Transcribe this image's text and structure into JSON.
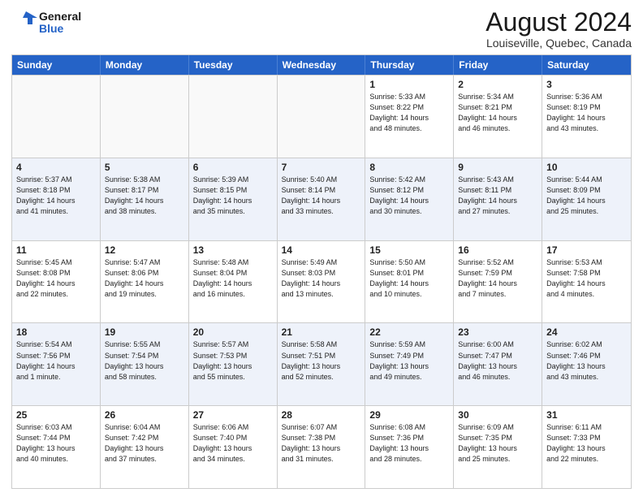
{
  "header": {
    "logo_line1": "General",
    "logo_line2": "Blue",
    "month": "August 2024",
    "location": "Louiseville, Quebec, Canada"
  },
  "days_of_week": [
    "Sunday",
    "Monday",
    "Tuesday",
    "Wednesday",
    "Thursday",
    "Friday",
    "Saturday"
  ],
  "weeks": [
    [
      {
        "day": "",
        "info": ""
      },
      {
        "day": "",
        "info": ""
      },
      {
        "day": "",
        "info": ""
      },
      {
        "day": "",
        "info": ""
      },
      {
        "day": "1",
        "info": "Sunrise: 5:33 AM\nSunset: 8:22 PM\nDaylight: 14 hours\nand 48 minutes."
      },
      {
        "day": "2",
        "info": "Sunrise: 5:34 AM\nSunset: 8:21 PM\nDaylight: 14 hours\nand 46 minutes."
      },
      {
        "day": "3",
        "info": "Sunrise: 5:36 AM\nSunset: 8:19 PM\nDaylight: 14 hours\nand 43 minutes."
      }
    ],
    [
      {
        "day": "4",
        "info": "Sunrise: 5:37 AM\nSunset: 8:18 PM\nDaylight: 14 hours\nand 41 minutes."
      },
      {
        "day": "5",
        "info": "Sunrise: 5:38 AM\nSunset: 8:17 PM\nDaylight: 14 hours\nand 38 minutes."
      },
      {
        "day": "6",
        "info": "Sunrise: 5:39 AM\nSunset: 8:15 PM\nDaylight: 14 hours\nand 35 minutes."
      },
      {
        "day": "7",
        "info": "Sunrise: 5:40 AM\nSunset: 8:14 PM\nDaylight: 14 hours\nand 33 minutes."
      },
      {
        "day": "8",
        "info": "Sunrise: 5:42 AM\nSunset: 8:12 PM\nDaylight: 14 hours\nand 30 minutes."
      },
      {
        "day": "9",
        "info": "Sunrise: 5:43 AM\nSunset: 8:11 PM\nDaylight: 14 hours\nand 27 minutes."
      },
      {
        "day": "10",
        "info": "Sunrise: 5:44 AM\nSunset: 8:09 PM\nDaylight: 14 hours\nand 25 minutes."
      }
    ],
    [
      {
        "day": "11",
        "info": "Sunrise: 5:45 AM\nSunset: 8:08 PM\nDaylight: 14 hours\nand 22 minutes."
      },
      {
        "day": "12",
        "info": "Sunrise: 5:47 AM\nSunset: 8:06 PM\nDaylight: 14 hours\nand 19 minutes."
      },
      {
        "day": "13",
        "info": "Sunrise: 5:48 AM\nSunset: 8:04 PM\nDaylight: 14 hours\nand 16 minutes."
      },
      {
        "day": "14",
        "info": "Sunrise: 5:49 AM\nSunset: 8:03 PM\nDaylight: 14 hours\nand 13 minutes."
      },
      {
        "day": "15",
        "info": "Sunrise: 5:50 AM\nSunset: 8:01 PM\nDaylight: 14 hours\nand 10 minutes."
      },
      {
        "day": "16",
        "info": "Sunrise: 5:52 AM\nSunset: 7:59 PM\nDaylight: 14 hours\nand 7 minutes."
      },
      {
        "day": "17",
        "info": "Sunrise: 5:53 AM\nSunset: 7:58 PM\nDaylight: 14 hours\nand 4 minutes."
      }
    ],
    [
      {
        "day": "18",
        "info": "Sunrise: 5:54 AM\nSunset: 7:56 PM\nDaylight: 14 hours\nand 1 minute."
      },
      {
        "day": "19",
        "info": "Sunrise: 5:55 AM\nSunset: 7:54 PM\nDaylight: 13 hours\nand 58 minutes."
      },
      {
        "day": "20",
        "info": "Sunrise: 5:57 AM\nSunset: 7:53 PM\nDaylight: 13 hours\nand 55 minutes."
      },
      {
        "day": "21",
        "info": "Sunrise: 5:58 AM\nSunset: 7:51 PM\nDaylight: 13 hours\nand 52 minutes."
      },
      {
        "day": "22",
        "info": "Sunrise: 5:59 AM\nSunset: 7:49 PM\nDaylight: 13 hours\nand 49 minutes."
      },
      {
        "day": "23",
        "info": "Sunrise: 6:00 AM\nSunset: 7:47 PM\nDaylight: 13 hours\nand 46 minutes."
      },
      {
        "day": "24",
        "info": "Sunrise: 6:02 AM\nSunset: 7:46 PM\nDaylight: 13 hours\nand 43 minutes."
      }
    ],
    [
      {
        "day": "25",
        "info": "Sunrise: 6:03 AM\nSunset: 7:44 PM\nDaylight: 13 hours\nand 40 minutes."
      },
      {
        "day": "26",
        "info": "Sunrise: 6:04 AM\nSunset: 7:42 PM\nDaylight: 13 hours\nand 37 minutes."
      },
      {
        "day": "27",
        "info": "Sunrise: 6:06 AM\nSunset: 7:40 PM\nDaylight: 13 hours\nand 34 minutes."
      },
      {
        "day": "28",
        "info": "Sunrise: 6:07 AM\nSunset: 7:38 PM\nDaylight: 13 hours\nand 31 minutes."
      },
      {
        "day": "29",
        "info": "Sunrise: 6:08 AM\nSunset: 7:36 PM\nDaylight: 13 hours\nand 28 minutes."
      },
      {
        "day": "30",
        "info": "Sunrise: 6:09 AM\nSunset: 7:35 PM\nDaylight: 13 hours\nand 25 minutes."
      },
      {
        "day": "31",
        "info": "Sunrise: 6:11 AM\nSunset: 7:33 PM\nDaylight: 13 hours\nand 22 minutes."
      }
    ]
  ],
  "alt_weeks": [
    1,
    3
  ]
}
